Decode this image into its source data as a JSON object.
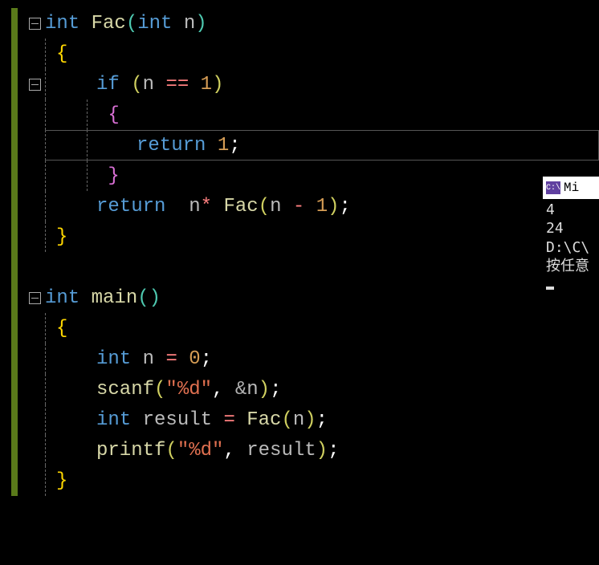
{
  "code": {
    "l1": {
      "kw_int": "int",
      "fn": "Fac",
      "p_o": "(",
      "kw_int2": "int",
      "id_n": " n",
      "p_c": ")"
    },
    "l2": {
      "brace": "{"
    },
    "l3": {
      "kw_if": "if",
      "p_o": " (",
      "id_n": "n ",
      "op": "==",
      "num": " 1",
      "p_c": ")"
    },
    "l4": {
      "brace": "{"
    },
    "l5": {
      "kw_return": "return",
      "num": " 1",
      "semi": ";"
    },
    "l6": {
      "brace": "}"
    },
    "l7": {
      "kw_return": "return",
      "sp": "  ",
      "id_n": "n",
      "op": "* ",
      "fn": "Fac",
      "p_o": "(",
      "id_n2": "n ",
      "op2": "-",
      "num": " 1",
      "p_c": ")",
      "semi": ";"
    },
    "l8": {
      "brace": "}"
    },
    "l10": {
      "kw_int": "int",
      "fn": " main",
      "p_o": "(",
      "p_c": ")"
    },
    "l11": {
      "brace": "{"
    },
    "l12": {
      "kw_int": "int",
      "id": " n ",
      "op": "=",
      "num": " 0",
      "semi": ";"
    },
    "l13": {
      "fn": "scanf",
      "p_o": "(",
      "str": "\"%d\"",
      "c": ",",
      "amp": " &",
      "id": "n",
      "p_c": ")",
      "semi": ";"
    },
    "l14": {
      "kw_int": "int",
      "id": " result ",
      "op": "=",
      "fn": " Fac",
      "p_o": "(",
      "id2": "n",
      "p_c": ")",
      "semi": ";"
    },
    "l15": {
      "fn": "printf",
      "p_o": "(",
      "str": "\"%d\"",
      "c": ",",
      "id": " result",
      "p_c": ")",
      "semi": ";"
    },
    "l16": {
      "brace": "}"
    }
  },
  "console": {
    "title": "Mi",
    "out1": "4",
    "out2": "24",
    "out3": "D:\\C\\",
    "out4": "按任意"
  }
}
